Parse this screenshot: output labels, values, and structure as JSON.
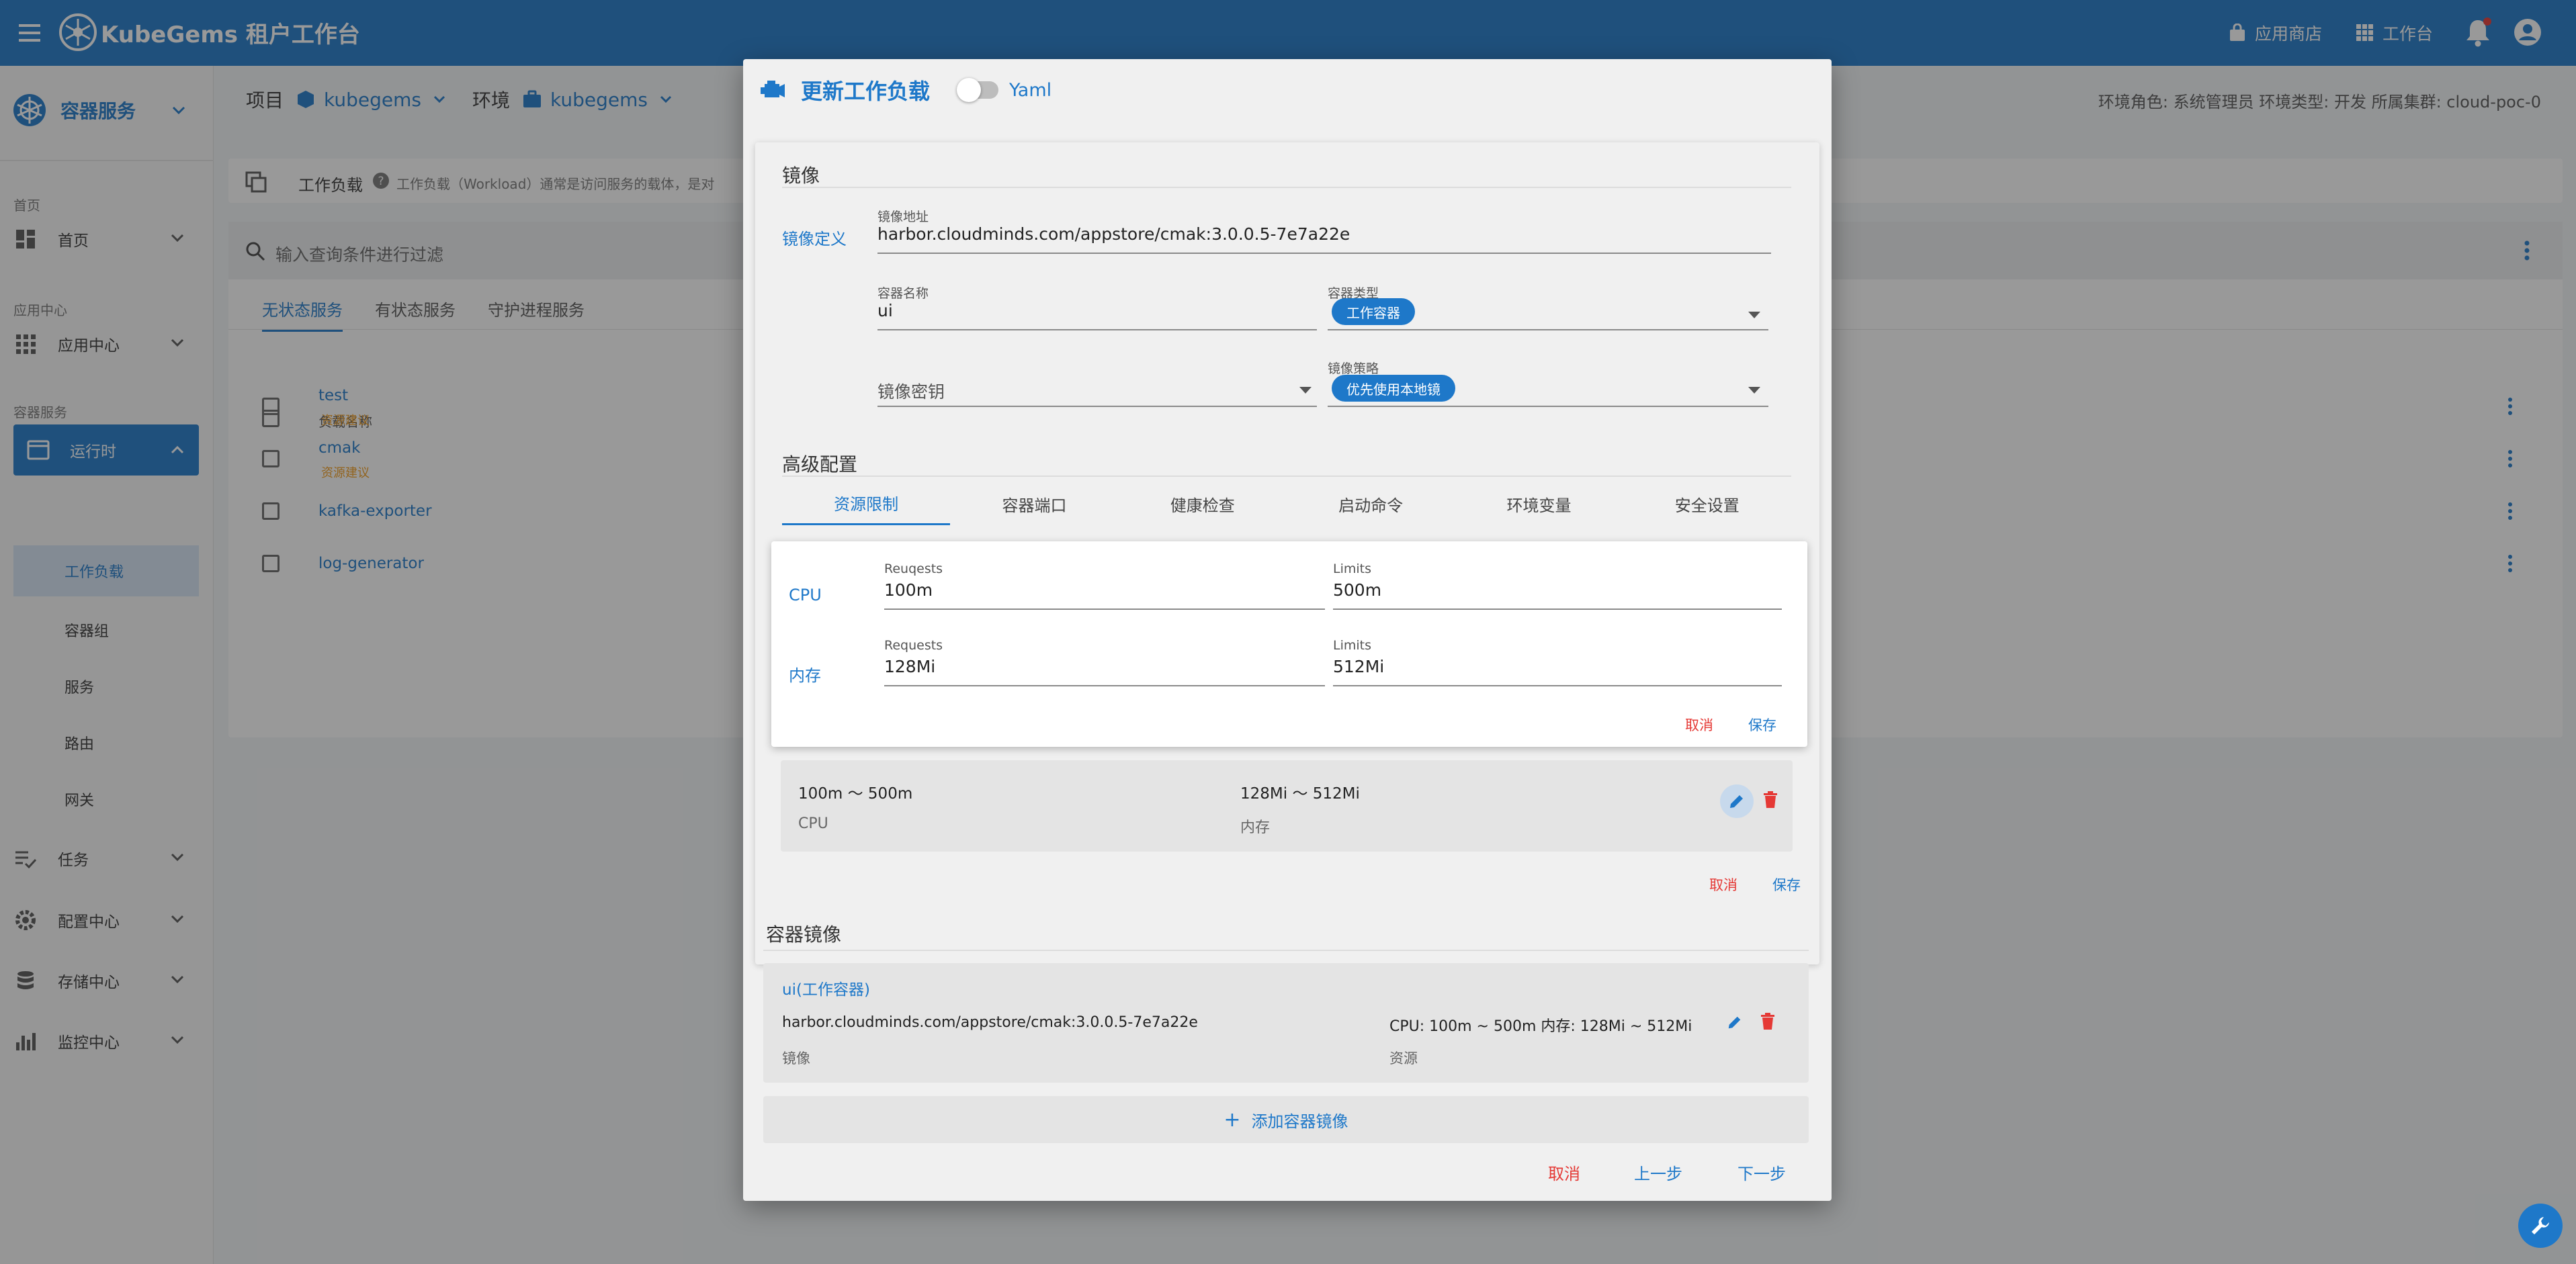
{
  "app": {
    "title": "KubeGems 租户工作台",
    "store_label": "应用商店",
    "workbench_label": "工作台"
  },
  "sidebar": {
    "service_selector": "容器服务",
    "groups": [
      "首页",
      "应用中心",
      "容器服务"
    ],
    "items": {
      "home": "首页",
      "appcenter": "应用中心",
      "runtime": "运行时",
      "tasks": "任务",
      "config": "配置中心",
      "storage": "存储中心",
      "monitor": "监控中心"
    },
    "runtime_children": [
      "工作负载",
      "容器组",
      "服务",
      "路由",
      "网关"
    ]
  },
  "header": {
    "project_label": "项目",
    "project_value": "kubegems",
    "env_label": "环境",
    "env_value": "kubegems",
    "env_info": "环境角色: 系统管理员    环境类型: 开发    所属集群: cloud-poc-0"
  },
  "workload": {
    "title": "工作负载",
    "description": "工作负载（Workload）通常是访问服务的载体，是对",
    "search_placeholder": "输入查询条件进行过滤",
    "tabs": [
      "无状态服务",
      "有状态服务",
      "守护进程服务"
    ],
    "column_name": "负载名称",
    "rows": [
      {
        "name": "test",
        "hint": "资源建议"
      },
      {
        "name": "cmak",
        "hint": "资源建议"
      },
      {
        "name": "kafka-exporter",
        "hint": ""
      },
      {
        "name": "log-generator",
        "hint": ""
      }
    ]
  },
  "dialog": {
    "title": "更新工作负载",
    "yaml_label": "Yaml",
    "image_section": "镜像",
    "image_def_label": "镜像定义",
    "image_addr_label": "镜像地址",
    "image_addr_value": "harbor.cloudminds.com/appstore/cmak:3.0.0.5-7e7a22e",
    "container_name_label": "容器名称",
    "container_name_value": "ui",
    "container_type_label": "容器类型",
    "container_type_value": "工作容器",
    "image_secret_placeholder": "镜像密钥",
    "image_policy_label": "镜像策略",
    "image_policy_value": "优先使用本地镜",
    "advanced_section": "高级配置",
    "adv_tabs": [
      "资源限制",
      "容器端口",
      "健康检查",
      "启动命令",
      "环境变量",
      "安全设置"
    ],
    "cpu_label": "CPU",
    "cpu_requests_label": "Reuqests",
    "cpu_requests_value": "100m",
    "cpu_limits_label": "Limits",
    "cpu_limits_value": "500m",
    "mem_label": "内存",
    "mem_requests_label": "Requests",
    "mem_requests_value": "128Mi",
    "mem_limits_label": "Limits",
    "mem_limits_value": "512Mi",
    "res_cancel": "取消",
    "res_save": "保存",
    "summary_cpu_value": "100m ～ 500m",
    "summary_cpu_label": "CPU",
    "summary_mem_value": "128Mi ～ 512Mi",
    "summary_mem_label": "内存",
    "section_cancel": "取消",
    "section_save": "保存",
    "container_images_section": "容器镜像",
    "image_card_title": "ui(工作容器)",
    "image_card_image": "harbor.cloudminds.com/appstore/cmak:3.0.0.5-7e7a22e",
    "image_card_image_label": "镜像",
    "image_card_resource": "CPU: 100m ~ 500m   内存: 128Mi ~ 512Mi",
    "image_card_resource_label": "资源",
    "add_image": "添加容器镜像",
    "footer_cancel": "取消",
    "footer_prev": "上一步",
    "footer_next": "下一步"
  },
  "colors": {
    "brand": "#1e78c9",
    "danger": "#e53935",
    "warning": "#f29d1f"
  }
}
